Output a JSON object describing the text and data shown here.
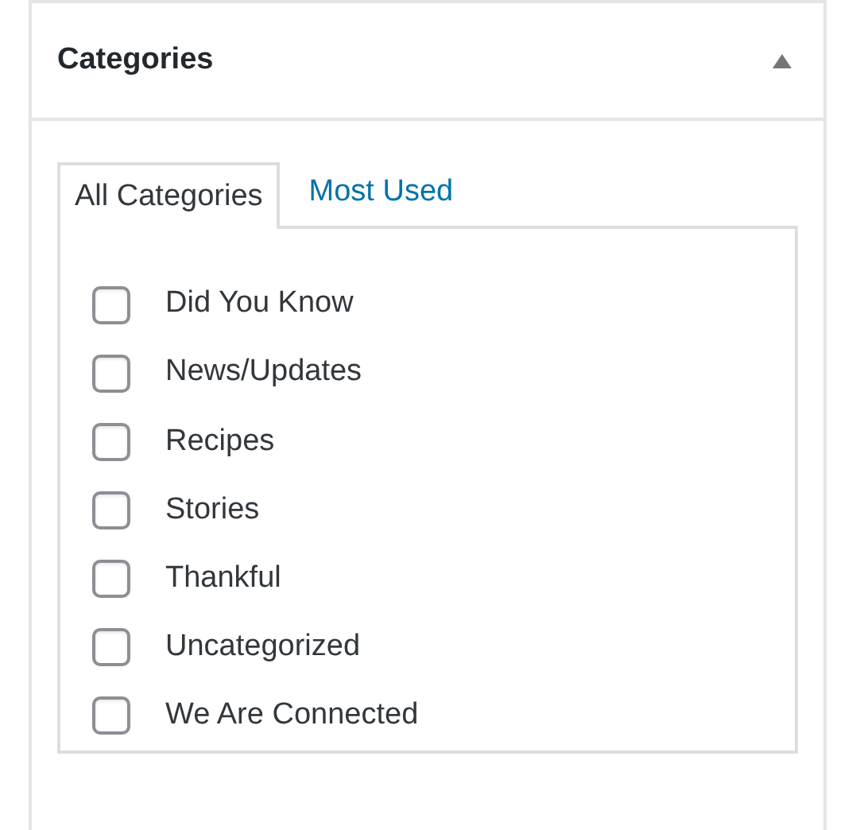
{
  "panel": {
    "title": "Categories",
    "expanded": true
  },
  "tabs": [
    {
      "label": "All Categories",
      "selected": true
    },
    {
      "label": "Most Used",
      "selected": false
    }
  ],
  "categories": [
    {
      "label": "Did You Know",
      "checked": false
    },
    {
      "label": "News/Updates",
      "checked": false
    },
    {
      "label": "Recipes",
      "checked": false
    },
    {
      "label": "Stories",
      "checked": false
    },
    {
      "label": "Thankful",
      "checked": false
    },
    {
      "label": "Uncategorized",
      "checked": false
    },
    {
      "label": "We Are Connected",
      "checked": false
    }
  ]
}
